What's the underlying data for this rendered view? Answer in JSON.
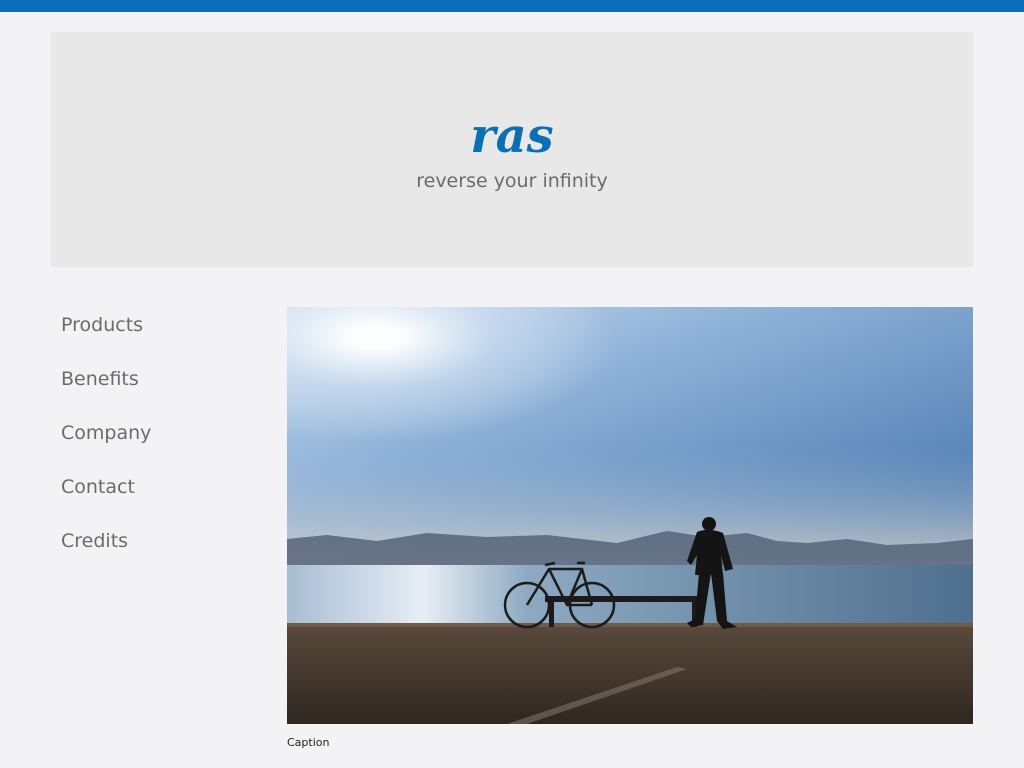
{
  "brand": {
    "name": "ras",
    "tagline": "reverse your infinity",
    "accent_color": "#0a6fb8"
  },
  "nav": {
    "items": [
      {
        "label": "Products"
      },
      {
        "label": "Benefits"
      },
      {
        "label": "Company"
      },
      {
        "label": "Contact"
      },
      {
        "label": "Credits"
      }
    ]
  },
  "figure": {
    "caption": "Caption"
  }
}
